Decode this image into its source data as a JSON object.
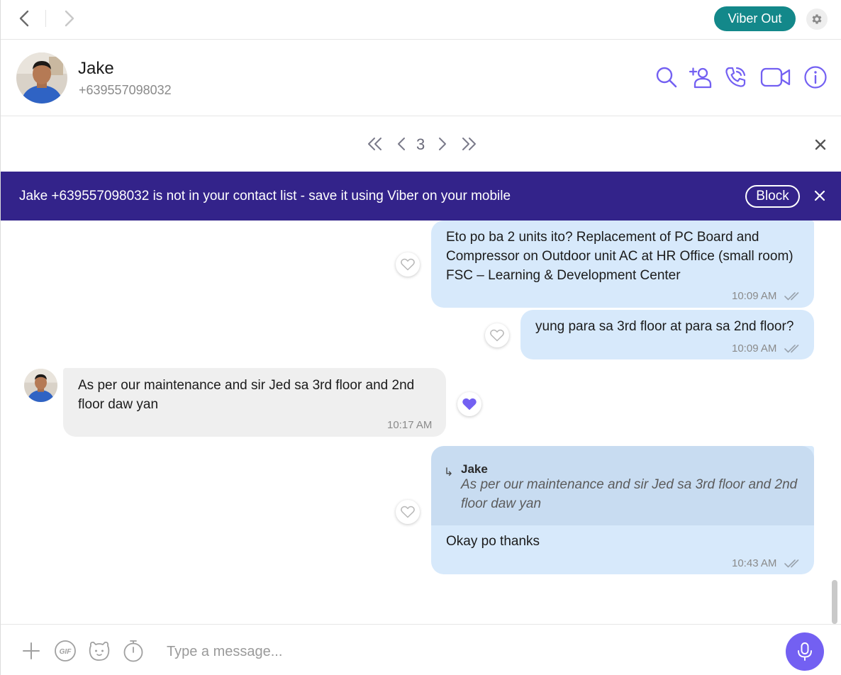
{
  "topbar": {
    "viber_out_label": "Viber Out"
  },
  "contact": {
    "name": "Jake",
    "phone": "+639557098032"
  },
  "pager": {
    "current_page": "3"
  },
  "banner": {
    "text": "Jake +639557098032 is not in your contact list - save it using Viber on your mobile",
    "block_label": "Block",
    "color": "#33238a"
  },
  "messages": [
    {
      "direction": "outgoing",
      "text": "Eto po ba 2 units ito? Replacement of PC Board and Compressor on Outdoor unit AC at HR Office (small room) FSC – Learning & Development Center",
      "time": "10:09 AM",
      "liked": false
    },
    {
      "direction": "outgoing",
      "text": "yung para sa 3rd floor at para sa 2nd floor?",
      "time": "10:09 AM",
      "liked": false
    },
    {
      "direction": "incoming",
      "text": "As per our maintenance and sir Jed sa 3rd floor and 2nd floor daw yan",
      "time": "10:17 AM",
      "liked": true
    },
    {
      "direction": "outgoing",
      "reply_to": {
        "name": "Jake",
        "text": "As per our maintenance and sir Jed sa 3rd floor and 2nd floor daw yan"
      },
      "text": "Okay po thanks",
      "time": "10:43 AM",
      "liked": false
    }
  ],
  "composer": {
    "placeholder": "Type a message..."
  },
  "colors": {
    "accent": "#7360f2",
    "viber_out": "#13888a",
    "outgoing_bubble": "#d7e9fb",
    "incoming_bubble": "#efefef",
    "quote_bg": "#c8dcf1"
  }
}
